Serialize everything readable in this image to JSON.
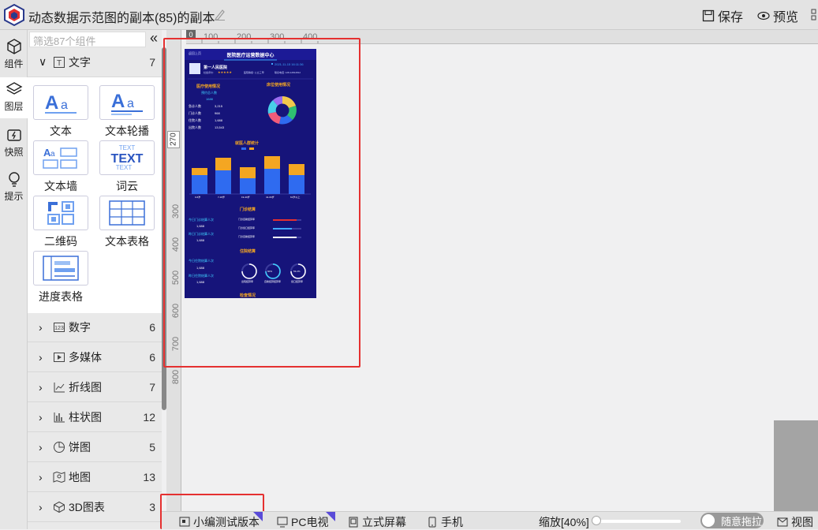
{
  "header": {
    "title": "动态数据示范图的副本(85)的副本",
    "save_label": "保存",
    "preview_label": "预览"
  },
  "rail": {
    "components": "组件",
    "layers": "图层",
    "snapshot": "快照",
    "tips": "提示"
  },
  "panel": {
    "filter_placeholder": "筛选87个组件",
    "text_category": {
      "label": "文字",
      "count": "7"
    },
    "tiles": [
      {
        "label": "文本"
      },
      {
        "label": "文本轮播"
      },
      {
        "label": "文本墙"
      },
      {
        "label": "词云"
      },
      {
        "label": "二维码"
      },
      {
        "label": "文本表格"
      },
      {
        "label": "进度表格"
      }
    ],
    "categories": [
      {
        "label": "数字",
        "count": "6"
      },
      {
        "label": "多媒体",
        "count": "6"
      },
      {
        "label": "折线图",
        "count": "7"
      },
      {
        "label": "柱状图",
        "count": "12"
      },
      {
        "label": "饼图",
        "count": "5"
      },
      {
        "label": "地图",
        "count": "13"
      },
      {
        "label": "3D图表",
        "count": "3"
      }
    ]
  },
  "rulers": {
    "top": [
      "100",
      "200",
      "300",
      "400"
    ],
    "corner": "0",
    "left_marker": "270",
    "left": [
      "300",
      "400",
      "500",
      "600",
      "700",
      "800"
    ]
  },
  "dashboard": {
    "back": "返回上页",
    "title": "医院医疗运营数据中心",
    "datetime": "2021-11-15 16:11:36",
    "hospital_name": "第一人民医院",
    "rating_label": "社会评价:",
    "stars": "★★★★★",
    "level": "医院等级: 公立三甲",
    "phone": "联系电话: 128-12812812",
    "section_usage": "医疗使用情况",
    "section_beds": "床位使用情况",
    "appt_label": "预约总人数",
    "appt_value": "1688",
    "stats": [
      {
        "label": "急诊人数",
        "value": "3,215"
      },
      {
        "label": "门诊人数",
        "value": "968"
      },
      {
        "label": "住院人数",
        "value": "1,688"
      },
      {
        "label": "出院人数",
        "value": "13,543"
      }
    ],
    "section_age": "就医人群统计",
    "age_groups": [
      "0-6岁",
      "7-18岁",
      "19-40岁",
      "41-60岁",
      "61岁以上"
    ],
    "section_outpatient": "门诊结算",
    "op_today_label": "今日门诊结算人次",
    "op_today_value": "1,688",
    "op_yest_label": "昨日门诊结算人次",
    "op_yest_value": "1,688",
    "op_bars": [
      "门诊自助结算率",
      "门诊窗口结算率",
      "门诊自助结算率"
    ],
    "section_inpatient": "住院结算",
    "ip_today_label": "今日住院结算人次",
    "ip_today_value": "1,688",
    "ip_yest_label": "昨日住院结算人次",
    "ip_yest_value": "1,688",
    "gauges": [
      "出院结算率",
      "自助结算结算率",
      "窗口结算率"
    ],
    "gauge_values": [
      "",
      "60%",
      "53.2%"
    ],
    "section_check": "检查情况"
  },
  "bottom": {
    "tab_mobile_test": "小编测试版本",
    "tab_pc": "PC电视",
    "tab_standing": "立式屏幕",
    "tab_phone": "手机",
    "zoom": "缩放[40%]",
    "drag_toggle": "随意拖拉",
    "view": "视图"
  },
  "colors": {
    "accent_red": "#e53030",
    "dash_bg": "#16147a",
    "bar_blue": "#2f6bf0",
    "bar_orange": "#f4a622"
  }
}
